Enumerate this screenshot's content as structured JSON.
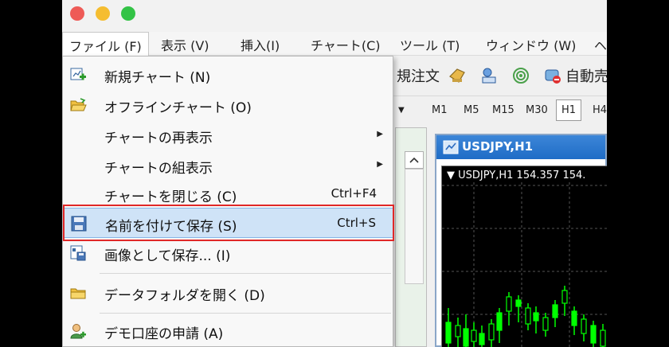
{
  "menubar": {
    "items": [
      "ファイル (F)",
      "表示 (V)",
      "挿入(I)",
      "チャート(C)",
      "ツール (T)",
      "ウィンドウ (W)",
      "ヘ"
    ]
  },
  "toolbar": {
    "new_order": "規注文",
    "auto_trade": "自動売"
  },
  "timeframes": [
    "M1",
    "M5",
    "M15",
    "M30",
    "H1",
    "H4"
  ],
  "chart": {
    "window_title": "USDJPY,H1",
    "header": "▼ USDJPY,H1  154.357 154."
  },
  "file_menu": {
    "items": [
      {
        "label": "新規チャート (N)",
        "shortcut": "",
        "icon": "new-chart-icon"
      },
      {
        "label": "オフラインチャート (O)",
        "shortcut": "",
        "icon": "folder-open-icon"
      },
      {
        "label": "チャートの再表示",
        "shortcut": "",
        "submenu": true
      },
      {
        "label": "チャートの組表示",
        "shortcut": "",
        "submenu": true
      },
      {
        "label": "チャートを閉じる (C)",
        "shortcut": "Ctrl+F4"
      },
      {
        "label": "名前を付けて保存 (S)",
        "shortcut": "Ctrl+S",
        "icon": "save-icon",
        "highlighted": true
      },
      {
        "label": "画像として保存... (I)",
        "shortcut": "",
        "icon": "save-image-icon"
      },
      {
        "label": "データフォルダを開く (D)",
        "shortcut": "",
        "icon": "folder-icon"
      },
      {
        "label": "デモ口座の申請 (A)",
        "shortcut": "",
        "icon": "user-add-icon"
      }
    ]
  },
  "colors": {
    "highlight": "#cfe3f7",
    "callout": "#e02828",
    "title_bar": "#1f6cc6",
    "candle": "#00ff00"
  }
}
